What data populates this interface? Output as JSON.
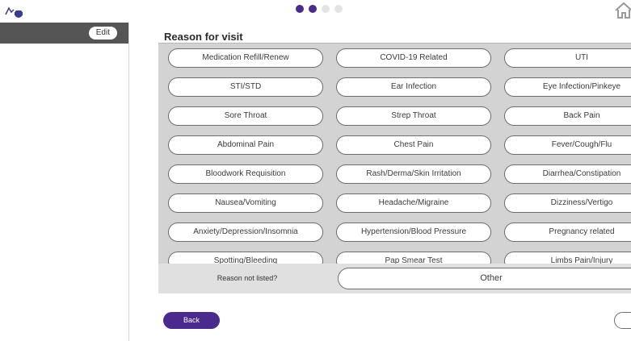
{
  "progress": {
    "total_steps": 4,
    "completed_steps": 2
  },
  "colors": {
    "accent": "#4a2a8c",
    "sidebar_header": "#555555",
    "grid_bg": "#d3d3d3"
  },
  "sidebar": {
    "edit_label": "Edit"
  },
  "main": {
    "title": "Reason for visit",
    "reasons": [
      [
        "Medication Refill/Renew",
        "COVID-19 Related",
        "UTI"
      ],
      [
        "STI/STD",
        "Ear Infection",
        "Eye Infection/Pinkeye"
      ],
      [
        "Sore Throat",
        "Strep Throat",
        "Back Pain"
      ],
      [
        "Abdominal Pain",
        "Chest Pain",
        "Fever/Cough/Flu"
      ],
      [
        "Bloodwork Requisition",
        "Rash/Derma/Skin Irritation",
        "Diarrhea/Constipation"
      ],
      [
        "Nausea/Vomiting",
        "Headache/Migraine",
        "Dizziness/Vertigo"
      ],
      [
        "Anxiety/Depression/Insomnia",
        "Hypertension/Blood Pressure",
        "Pregnancy related"
      ],
      [
        "Spotting/Bleeding",
        "Pap Smear Test",
        "Limbs Pain/Injury"
      ]
    ],
    "not_listed_label": "Reason not listed?",
    "other_label": "Other",
    "back_label": "Back"
  }
}
